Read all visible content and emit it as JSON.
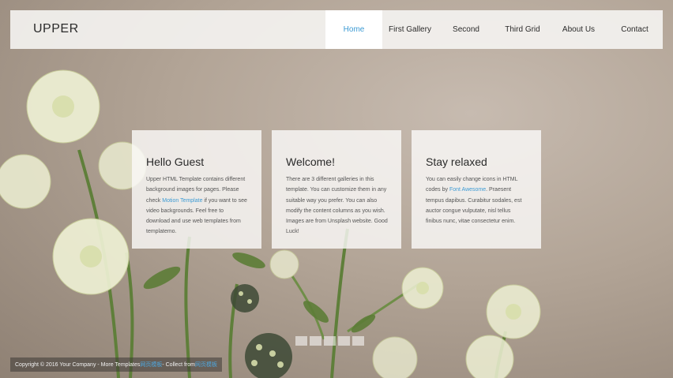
{
  "brand": "UPPER",
  "nav": {
    "items": [
      {
        "label": "Home",
        "active": true
      },
      {
        "label": "First Gallery",
        "active": false
      },
      {
        "label": "Second",
        "active": false
      },
      {
        "label": "Third Grid",
        "active": false
      },
      {
        "label": "About Us",
        "active": false
      },
      {
        "label": "Contact",
        "active": false
      }
    ]
  },
  "cards": [
    {
      "title": "Hello Guest",
      "text_before_link": "Upper HTML Template contains different background images for pages. Please check ",
      "link": "Motion Template",
      "text_after_link": " if you want to see video backgrounds. Feel free to download and use web templates from templatemo."
    },
    {
      "title": "Welcome!",
      "text": "There are 3 different galleries in this template. You can customize them in any suitable way you prefer. You can also modify the content columns as you wish. Images are from Unsplash website. Good Luck!"
    },
    {
      "title": "Stay relaxed",
      "text_before_link": "You can easily change icons in HTML codes by ",
      "link": "Font Awesome",
      "text_after_link": ". Praesent tempus dapibus. Curabitur sodales, est auctor congue vulputate, nisl tellus finibus nunc, vitae consectetur enim."
    }
  ],
  "gallery_indicators": 5,
  "footer": {
    "text": "Copyright © 2016 Your Company - More Templates ",
    "link1": "网页模板",
    "middle": " - Collect from ",
    "link2": "网页模板"
  },
  "colors": {
    "accent": "#3d9bd4",
    "navbar_bg": "#f5f4f2",
    "card_bg": "#faf9f8"
  }
}
